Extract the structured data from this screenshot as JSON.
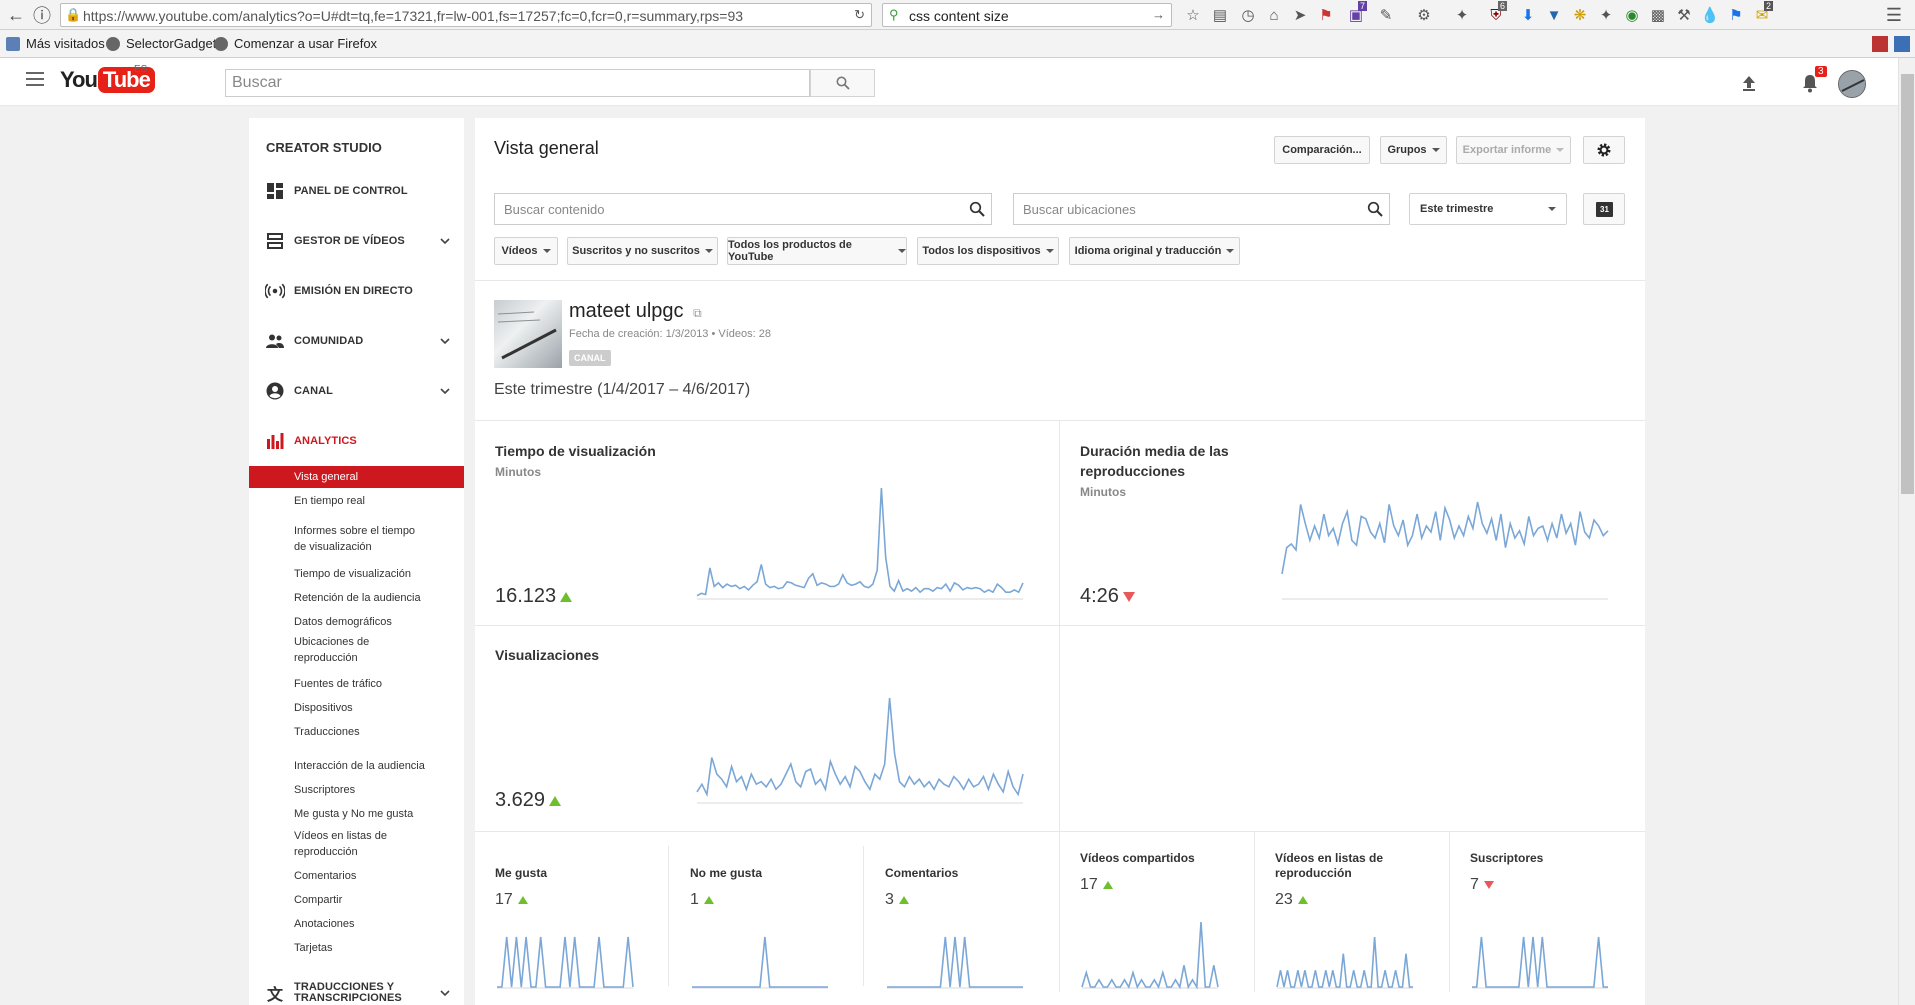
{
  "browser": {
    "url": "https://www.youtube.com/analytics?o=U#dt=tq,fe=17321,fr=lw-001,fs=17257;fc=0,fcr=0,r=summary,rps=93",
    "search_value": "css content size",
    "bookmarks": [
      "Más visitados",
      "SelectorGadget",
      "Comenzar a usar Firefox"
    ],
    "badges": {
      "twitch": "7",
      "ublock": "6",
      "ext": "2"
    }
  },
  "header": {
    "logo_you": "You",
    "logo_tube": "Tube",
    "logo_region": "ES",
    "search_placeholder": "Buscar",
    "notification_count": "3"
  },
  "sidebar": {
    "title": "CREATOR STUDIO",
    "sections": [
      {
        "label": "PANEL DE CONTROL",
        "icon": "dashboard-icon"
      },
      {
        "label": "GESTOR DE VÍDEOS",
        "icon": "video-manager-icon"
      },
      {
        "label": "EMISIÓN EN DIRECTO",
        "icon": "live-icon"
      },
      {
        "label": "COMUNIDAD",
        "icon": "community-icon"
      },
      {
        "label": "CANAL",
        "icon": "channel-icon"
      },
      {
        "label": "ANALYTICS",
        "icon": "analytics-icon"
      },
      {
        "label": "TRADUCCIONES Y TRANSCRIPCIONES",
        "icon": "translate-icon"
      }
    ],
    "analytics_items": [
      "Vista general",
      "En tiempo real",
      "Informes sobre el tiempo de visualización",
      "Tiempo de visualización",
      "Retención de la audiencia",
      "Datos demográficos",
      "Ubicaciones de reproducción",
      "Fuentes de tráfico",
      "Dispositivos",
      "Traducciones",
      "Interacción de la audiencia",
      "Suscriptores",
      "Me gusta y No me gusta",
      "Vídeos en listas de reproducción",
      "Comentarios",
      "Compartir",
      "Anotaciones",
      "Tarjetas"
    ],
    "accent_color": "#cc181e"
  },
  "main": {
    "title": "Vista general",
    "buttons": {
      "compare": "Comparación...",
      "groups": "Grupos",
      "export": "Exportar informe"
    },
    "search_content_placeholder": "Buscar contenido",
    "search_locations_placeholder": "Buscar ubicaciones",
    "period_select": "Este trimestre",
    "calendar_day": "31",
    "filters": [
      "Vídeos",
      "Suscritos y no suscritos",
      "Todos los productos de YouTube",
      "Todos los dispositivos",
      "Idioma original y traducción"
    ],
    "channel": {
      "name": "mateet ulpgc",
      "meta": "Fecha de creación: 1/3/2013  •  Vídeos: 28",
      "badge": "CANAL"
    },
    "date_range": "Este trimestre (1/4/2017 – 4/6/2017)",
    "metrics": {
      "watch_time": {
        "title": "Tiempo de visualización",
        "unit": "Minutos",
        "value": "16.123",
        "trend": "up"
      },
      "avg_duration": {
        "title": "Duración media de las reproducciones",
        "unit": "Minutos",
        "value": "4:26",
        "trend": "down"
      },
      "views": {
        "title": "Visualizaciones",
        "value": "3.629",
        "trend": "up"
      }
    },
    "engagement": [
      {
        "title": "Me gusta",
        "value": "17",
        "trend": "up"
      },
      {
        "title": "No me gusta",
        "value": "1",
        "trend": "up"
      },
      {
        "title": "Comentarios",
        "value": "3",
        "trend": "up"
      },
      {
        "title": "Vídeos compartidos",
        "value": "17",
        "trend": "up"
      },
      {
        "title": "Vídeos en listas de reproducción",
        "value": "23",
        "trend": "up"
      },
      {
        "title": "Suscriptores",
        "value": "7",
        "trend": "down"
      }
    ]
  },
  "chart_data": [
    {
      "type": "line",
      "title": "Tiempo de visualización",
      "series": [
        {
          "values": [
            2,
            4,
            3,
            26,
            10,
            13,
            9,
            12,
            10,
            11,
            8,
            10,
            7,
            11,
            14,
            29,
            12,
            9,
            10,
            8,
            9,
            14,
            13,
            11,
            10,
            9,
            17,
            21,
            11,
            13,
            12,
            10,
            10,
            12,
            20,
            13,
            11,
            12,
            14,
            10,
            9,
            12,
            24,
            95,
            35,
            10,
            6,
            15,
            6,
            8,
            6,
            9,
            5,
            8,
            8,
            6,
            9,
            8,
            12,
            6,
            13,
            11,
            7,
            9,
            8,
            9,
            8,
            5,
            7,
            5,
            12,
            9,
            5,
            5,
            7,
            5,
            13
          ]
        }
      ]
    },
    {
      "type": "line",
      "title": "Duración media de las reproducciones",
      "series": [
        {
          "values": [
            20,
            42,
            45,
            40,
            78,
            62,
            48,
            60,
            50,
            70,
            52,
            58,
            45,
            62,
            72,
            48,
            44,
            68,
            66,
            55,
            50,
            62,
            46,
            78,
            60,
            52,
            65,
            44,
            52,
            70,
            50,
            60,
            55,
            72,
            48,
            75,
            65,
            50,
            60,
            52,
            68,
            58,
            80,
            62,
            54,
            66,
            48,
            70,
            42,
            62,
            50,
            56,
            45,
            68,
            52,
            58,
            60,
            48,
            62,
            50,
            70,
            54,
            62,
            44,
            72,
            55,
            50,
            65,
            60,
            52,
            56
          ]
        }
      ]
    },
    {
      "type": "line",
      "title": "Visualizaciones",
      "series": [
        {
          "values": [
            8,
            14,
            6,
            35,
            22,
            18,
            12,
            28,
            16,
            20,
            10,
            22,
            14,
            16,
            12,
            18,
            10,
            14,
            22,
            30,
            16,
            12,
            24,
            26,
            14,
            18,
            10,
            32,
            22,
            14,
            20,
            12,
            28,
            24,
            16,
            10,
            22,
            18,
            30,
            82,
            38,
            16,
            12,
            20,
            14,
            18,
            12,
            16,
            10,
            18,
            14,
            12,
            20,
            16,
            10,
            18,
            12,
            14,
            20,
            10,
            22,
            14,
            8,
            24,
            12,
            6,
            22
          ]
        }
      ]
    },
    {
      "type": "line",
      "title": "Me gusta",
      "series": [
        {
          "values": [
            0,
            0,
            1,
            0,
            1,
            0,
            1,
            0,
            0,
            1,
            0,
            0,
            0,
            0,
            1,
            0,
            1,
            0,
            0,
            0,
            0,
            1,
            0,
            0,
            0,
            0,
            0,
            1,
            0
          ]
        }
      ]
    },
    {
      "type": "line",
      "title": "No me gusta",
      "series": [
        {
          "values": [
            0,
            0,
            0,
            0,
            0,
            0,
            0,
            0,
            0,
            0,
            0,
            0,
            0,
            0,
            0,
            1,
            0,
            0,
            0,
            0,
            0,
            0,
            0,
            0,
            0,
            0,
            0,
            0,
            0
          ]
        }
      ]
    },
    {
      "type": "line",
      "title": "Comentarios",
      "series": [
        {
          "values": [
            0,
            0,
            0,
            0,
            0,
            0,
            0,
            0,
            0,
            0,
            0,
            0,
            1,
            0,
            1,
            0,
            1,
            0,
            0,
            0,
            0,
            0,
            0,
            0,
            0,
            0,
            0,
            0,
            0
          ]
        }
      ]
    },
    {
      "type": "line",
      "title": "Vídeos compartidos",
      "series": [
        {
          "values": [
            0,
            2,
            0,
            0,
            1,
            0,
            0,
            1,
            0,
            0,
            1,
            0,
            2,
            0,
            1,
            0,
            0,
            1,
            0,
            2,
            0,
            0,
            1,
            0,
            3,
            0,
            1,
            0,
            9,
            0,
            0,
            3,
            0
          ]
        }
      ]
    },
    {
      "type": "line",
      "title": "Vídeos en listas de reproducción",
      "series": [
        {
          "values": [
            0,
            1,
            0,
            1,
            0,
            0,
            1,
            0,
            1,
            0,
            0,
            1,
            0,
            0,
            1,
            0,
            1,
            0,
            0,
            2,
            0,
            0,
            1,
            0,
            0,
            1,
            0,
            0,
            3,
            0,
            0,
            1,
            0,
            0,
            1,
            0,
            0,
            2,
            0,
            0
          ]
        }
      ]
    },
    {
      "type": "line",
      "title": "Suscriptores",
      "series": [
        {
          "values": [
            0,
            0,
            1,
            0,
            0,
            0,
            0,
            0,
            0,
            0,
            0,
            1,
            0,
            1,
            0,
            1,
            0,
            0,
            0,
            0,
            0,
            0,
            0,
            0,
            0,
            0,
            0,
            1,
            0,
            0
          ]
        }
      ]
    }
  ]
}
